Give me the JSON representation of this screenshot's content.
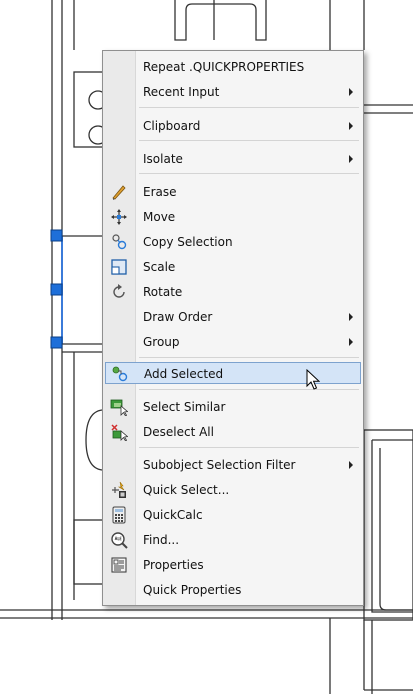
{
  "context_menu": {
    "items": [
      {
        "label": "Repeat .QUICKPROPERTIES",
        "icon": "",
        "submenu": false
      },
      {
        "label": "Recent Input",
        "icon": "",
        "submenu": true
      },
      {
        "label": "Clipboard",
        "icon": "",
        "submenu": true
      },
      {
        "label": "Isolate",
        "icon": "",
        "submenu": true
      },
      {
        "label": "Erase",
        "icon": "eraser-icon",
        "submenu": false
      },
      {
        "label": "Move",
        "icon": "move-icon",
        "submenu": false
      },
      {
        "label": "Copy Selection",
        "icon": "copy-selection-icon",
        "submenu": false
      },
      {
        "label": "Scale",
        "icon": "scale-icon",
        "submenu": false
      },
      {
        "label": "Rotate",
        "icon": "rotate-icon",
        "submenu": false
      },
      {
        "label": "Draw Order",
        "icon": "",
        "submenu": true
      },
      {
        "label": "Group",
        "icon": "",
        "submenu": true
      },
      {
        "label": "Add Selected",
        "icon": "add-selected-icon",
        "submenu": false,
        "highlighted": true
      },
      {
        "label": "Select Similar",
        "icon": "select-similar-icon",
        "submenu": false
      },
      {
        "label": "Deselect All",
        "icon": "deselect-all-icon",
        "submenu": false
      },
      {
        "label": "Subobject Selection Filter",
        "icon": "",
        "submenu": true
      },
      {
        "label": "Quick Select...",
        "icon": "quick-select-icon",
        "submenu": false
      },
      {
        "label": "QuickCalc",
        "icon": "calculator-icon",
        "submenu": false
      },
      {
        "label": "Find...",
        "icon": "find-icon",
        "submenu": false
      },
      {
        "label": "Properties",
        "icon": "properties-icon",
        "submenu": false
      },
      {
        "label": "Quick Properties",
        "icon": "",
        "submenu": false
      }
    ]
  },
  "colors": {
    "highlight": "#d4e4f7",
    "highlight_border": "#7da2ce",
    "grip": "#1e6fd9",
    "selection_line": "#3b7bd9"
  }
}
